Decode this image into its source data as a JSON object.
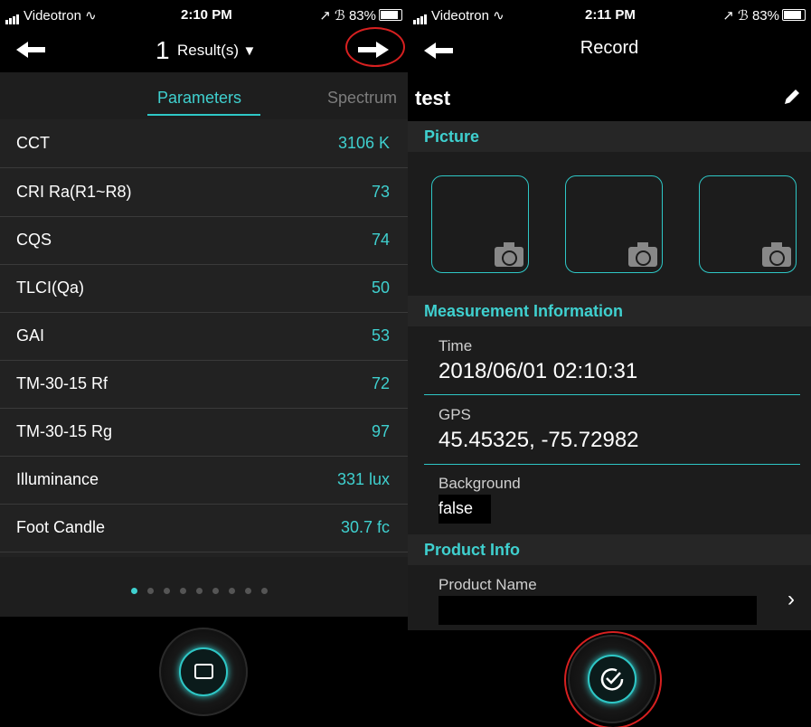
{
  "left": {
    "status": {
      "carrier": "Videotron",
      "time": "2:10 PM",
      "battery": "83%"
    },
    "nav": {
      "count": "1",
      "label": "Result(s)",
      "caret": "▼"
    },
    "tabs": [
      "Parameters",
      "Spectrum"
    ],
    "params": [
      {
        "label": "CCT",
        "value": "3106 K"
      },
      {
        "label": "CRI Ra(R1~R8)",
        "value": "73"
      },
      {
        "label": "CQS",
        "value": "74"
      },
      {
        "label": "TLCI(Qa)",
        "value": "50"
      },
      {
        "label": "GAI",
        "value": "53"
      },
      {
        "label": "TM-30-15 Rf",
        "value": "72"
      },
      {
        "label": "TM-30-15 Rg",
        "value": "97"
      },
      {
        "label": "Illuminance",
        "value": "331 lux"
      },
      {
        "label": "Foot Candle",
        "value": "30.7 fc"
      }
    ],
    "pager": {
      "total": 9,
      "active": 0
    }
  },
  "right": {
    "status": {
      "carrier": "Videotron",
      "time": "2:11 PM",
      "battery": "83%"
    },
    "title": "Record",
    "record_name": "test",
    "sections": {
      "picture": "Picture",
      "measurement": "Measurement Information",
      "product": "Product Info"
    },
    "measurement": {
      "time_label": "Time",
      "time_value": "2018/06/01 02:10:31",
      "gps_label": "GPS",
      "gps_value": "45.45325, -75.72982",
      "background_label": "Background",
      "background_value": "false"
    },
    "product": {
      "name_label": "Product Name",
      "name_value": ""
    }
  },
  "colors": {
    "accent": "#3fd0cf",
    "highlight": "#d72020",
    "section": "#262626"
  }
}
